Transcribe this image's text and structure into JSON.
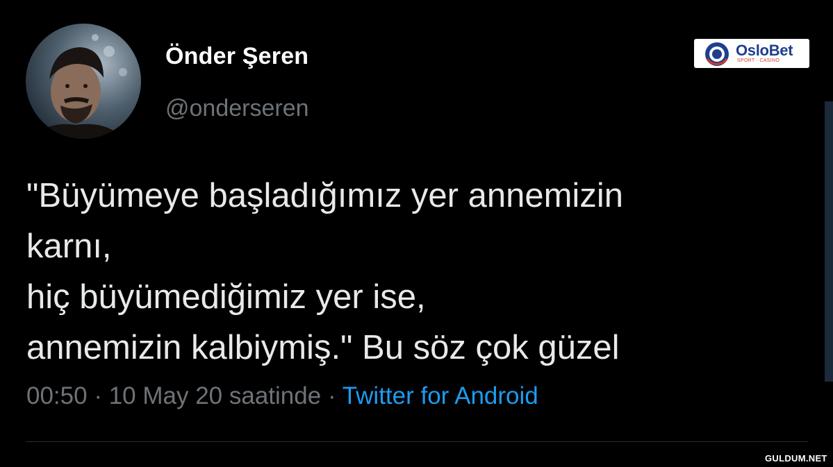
{
  "author": {
    "display_name": "Önder Şeren",
    "handle": "@onderseren"
  },
  "tweet": {
    "lines": [
      "\"Büyümeye başladığımız yer annemizin",
      "karnı,",
      "hiç büyümediğimiz yer ise,",
      "annemizin kalbiymiş.\" Bu söz çok güzel"
    ],
    "time": "00:50",
    "separator": "·",
    "date": "10 May 20 saatinde",
    "source": "Twitter for Android"
  },
  "sponsor": {
    "name": "OsloBet",
    "tagline": "SPORT · CASINO"
  },
  "watermark": "GULDUM.NET",
  "colors": {
    "background": "#000000",
    "text": "#e7e9ea",
    "muted": "#6e7378",
    "link": "#1d9bf0",
    "sponsor_blue": "#1f3f8f",
    "sponsor_red": "#d33a2c"
  }
}
